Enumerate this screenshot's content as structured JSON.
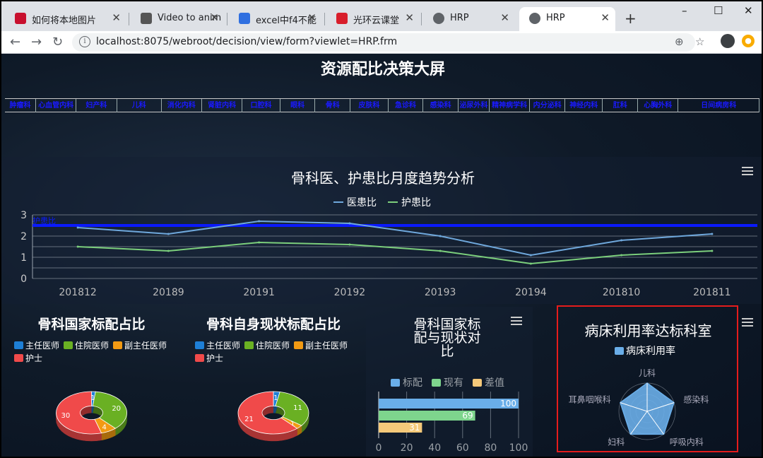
{
  "browser": {
    "tabs": [
      {
        "label": "如何将本地图片",
        "icon": "csdn-icon",
        "active": false
      },
      {
        "label": "Video to anim",
        "icon": "video-icon",
        "active": false
      },
      {
        "label": "excel中f4不能",
        "icon": "paw-icon",
        "active": false
      },
      {
        "label": "光环云课堂",
        "icon": "guanghuan-icon",
        "active": false
      },
      {
        "label": "HRP",
        "icon": "globe-icon",
        "active": false
      },
      {
        "label": "HRP",
        "icon": "globe-icon",
        "active": true
      }
    ],
    "new_tab": "+",
    "window_controls": {
      "minimize": "–",
      "maximize": "☐",
      "close": "✕"
    },
    "url": "localhost:8075/webroot/decision/view/form?viewlet=HRP.frm"
  },
  "dashboard": {
    "title": "资源配比决策大屏",
    "departments": [
      "肿瘤科",
      "心血管内科",
      "妇产科",
      "儿科",
      "消化内科",
      "肾脏内科",
      "口腔科",
      "眼科",
      "骨科",
      "皮肤科",
      "急诊科",
      "感染科",
      "泌尿外科",
      "精神病学科",
      "内分泌科",
      "神经内科",
      "肛科",
      "心胸外科",
      "日间病房科"
    ]
  },
  "trend": {
    "title": "骨科医、护患比月度趋势分析",
    "menu_icon": "hamburger-icon",
    "chart_data": {
      "type": "line",
      "categories": [
        "201812",
        "20189",
        "20191",
        "20192",
        "20193",
        "20194",
        "201810",
        "201811"
      ],
      "series": [
        {
          "name": "医患比",
          "values": [
            2.4,
            2.1,
            2.7,
            2.6,
            2.0,
            1.1,
            1.8,
            2.1
          ],
          "color": "#6fa8dc"
        },
        {
          "name": "护患比",
          "values": [
            1.5,
            1.3,
            1.7,
            1.6,
            1.3,
            0.7,
            1.1,
            1.3
          ],
          "color": "#7ccf7c"
        }
      ],
      "ylim": [
        0,
        3
      ],
      "yticks": [
        "0",
        "1",
        "2",
        "3"
      ],
      "markline": {
        "label": "护患比",
        "value": 2.5,
        "color": "#0a1aff"
      },
      "legend": "top-center",
      "grid": true
    }
  },
  "pies": [
    {
      "title": "骨科国家标配占比",
      "legend": [
        "主任医师",
        "住院医师",
        "副主任医师",
        "护士"
      ],
      "chart_data": {
        "type": "pie",
        "categories": [
          "主任医师",
          "住院医师",
          "副主任医师",
          "护士"
        ],
        "values": [
          1,
          20,
          4,
          30
        ],
        "labels": [
          "1",
          "20",
          "4",
          "30"
        ],
        "colors": [
          "#1e7fd6",
          "#6ab023",
          "#f29a13",
          "#f04a4a"
        ]
      }
    },
    {
      "title": "骨科自身现状标配占比",
      "legend": [
        "主任医师",
        "住院医师",
        "副主任医师",
        "护士"
      ],
      "chart_data": {
        "type": "pie",
        "categories": [
          "主任医师",
          "住院医师",
          "副主任医师",
          "护士"
        ],
        "values": [
          1,
          11,
          1,
          21
        ],
        "labels": [
          "1",
          "11",
          "1",
          "21"
        ],
        "colors": [
          "#1e7fd6",
          "#6ab023",
          "#f29a13",
          "#f04a4a"
        ]
      }
    }
  ],
  "bars": {
    "title_lines": [
      "骨科国家标",
      "配与现状对",
      "比"
    ],
    "menu_icon": "hamburger-icon",
    "chart_data": {
      "type": "bar",
      "orientation": "horizontal",
      "series": [
        {
          "name": "标配",
          "value": 100,
          "color": "#6aaee9"
        },
        {
          "name": "现有",
          "value": 69,
          "color": "#7ed58d"
        },
        {
          "name": "差值",
          "value": 31,
          "color": "#f5c97a"
        }
      ],
      "xlim": [
        0,
        100
      ],
      "xticks": [
        "0",
        "20",
        "40",
        "60",
        "80",
        "100"
      ],
      "legend": "top"
    }
  },
  "radar": {
    "title": "病床利用率达标科室",
    "menu_icon": "hamburger-icon",
    "legend": "病床利用率",
    "chart_data": {
      "type": "radar",
      "series_name": "病床利用率",
      "indicators": [
        "儿科",
        "感染科",
        "呼吸内科",
        "妇科",
        "耳鼻咽喉科"
      ],
      "values": [
        1,
        1,
        1,
        1,
        1
      ],
      "color": "#6aaee9"
    }
  }
}
